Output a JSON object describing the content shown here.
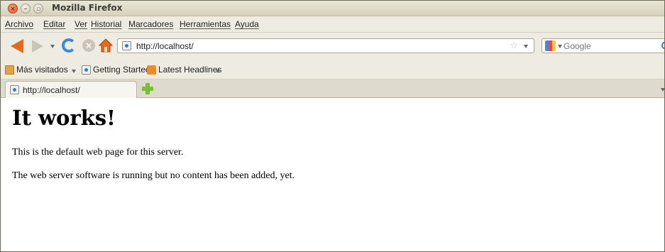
{
  "window": {
    "title": "Mozilla Firefox",
    "controls": [
      "close",
      "minimize",
      "maximize"
    ]
  },
  "menubar": {
    "items": [
      {
        "label": "Archivo"
      },
      {
        "label": "Editar"
      },
      {
        "label": "Ver"
      },
      {
        "label": "Historial"
      },
      {
        "label": "Marcadores"
      },
      {
        "label": "Herramientas"
      },
      {
        "label": "Ayuda"
      }
    ]
  },
  "navbar": {
    "url": "http://localhost/",
    "search_placeholder": "Google",
    "icons": [
      "back-arrow-icon",
      "forward-arrow-icon",
      "history-dropdown-icon",
      "reload-icon",
      "stop-icon",
      "home-icon",
      "bookmark-star-icon",
      "google-engine-icon",
      "search-icon"
    ]
  },
  "bookmarks": {
    "items": [
      {
        "label": "Más visitados",
        "icon": "folder-icon"
      },
      {
        "label": "Getting Started",
        "icon": "page-icon"
      },
      {
        "label": "Latest Headlines",
        "icon": "rss-icon"
      }
    ]
  },
  "tabs": [
    {
      "label": "http://localhost/",
      "active": true
    }
  ],
  "page": {
    "heading": "It works!",
    "paragraphs": [
      "This is the default web page for this server.",
      "The web server software is running but no content has been added, yet."
    ]
  },
  "colors": {
    "chrome_bg": "#edebe2",
    "titlebar_bg": "#dcd8c4",
    "back_arrow": "#e46a1d",
    "reload": "#3a8bd6",
    "newtab_plus": "#7bbd32",
    "close_button": "#e2582b"
  }
}
